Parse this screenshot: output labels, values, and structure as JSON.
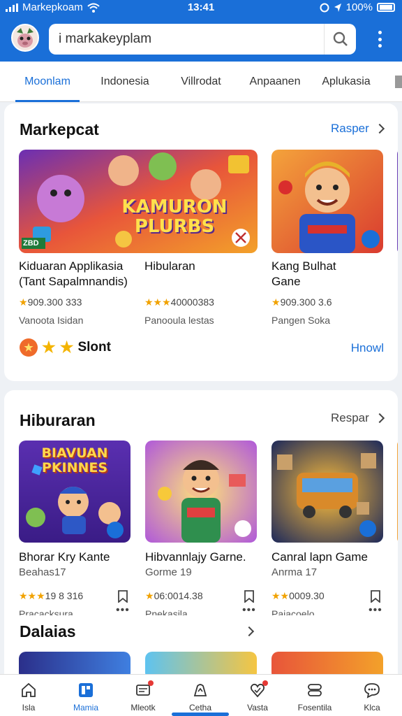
{
  "status_bar": {
    "carrier": "Markepkoam",
    "time": "13:41",
    "battery": "100%"
  },
  "search": {
    "value": "i markakeyplam"
  },
  "tabs": [
    {
      "label": "Moonlam",
      "active": true
    },
    {
      "label": "Indonesia",
      "active": false
    },
    {
      "label": "Villrodat",
      "active": false
    },
    {
      "label": "Anpaanen",
      "active": false
    },
    {
      "label": "Aplukasia",
      "active": false
    }
  ],
  "section1": {
    "title": "Markepcat",
    "see_more": "Rasper",
    "banner_text": "KAMURON PLURBS",
    "banner_tag": "ZBD",
    "apps": [
      {
        "name": "Kiduaran Applikasia\n(Tant Sapalmnandis)",
        "rating": "909.300 333",
        "category": "Vanoota Isidan"
      },
      {
        "name": "Hibularan",
        "rating": "40000383",
        "category": "Panooula lestas"
      },
      {
        "name": "Kang Bulhat\nGane",
        "rating": "909.300 3.6",
        "category": "Pangen Soka"
      }
    ],
    "badge_text": "Slont",
    "link_text": "Hnowl"
  },
  "section2": {
    "title": "Hiburaran",
    "see_more": "Respar",
    "apps": [
      {
        "name": "Bhorar Kry Kante",
        "sub": "Beahas17",
        "rating": "19 8 316",
        "category": "Pracacksura",
        "thumb_text": "BIAVUAN PKINNES"
      },
      {
        "name": "Hibvannlajy Garne.",
        "sub": "Gorme 19",
        "rating": "06:0014.38",
        "category": "Pnekasila"
      },
      {
        "name": "Canral lapn Game",
        "sub": "Anrma 17",
        "rating": "0009.30",
        "category": "Paiacoelo"
      }
    ]
  },
  "section3": {
    "title": "Dalaias"
  },
  "bottom_nav": [
    {
      "label": "Isla",
      "icon": "home-icon"
    },
    {
      "label": "Mamia",
      "icon": "apps-icon",
      "active": true
    },
    {
      "label": "Mleotk",
      "icon": "message-icon"
    },
    {
      "label": "Cetha",
      "icon": "game-icon"
    },
    {
      "label": "Vasta",
      "icon": "heart-icon"
    },
    {
      "label": "Fosentila",
      "icon": "link-icon"
    },
    {
      "label": "Klca",
      "icon": "chat-icon"
    }
  ],
  "colors": {
    "primary": "#1a6fd8",
    "star": "#f1a200"
  }
}
